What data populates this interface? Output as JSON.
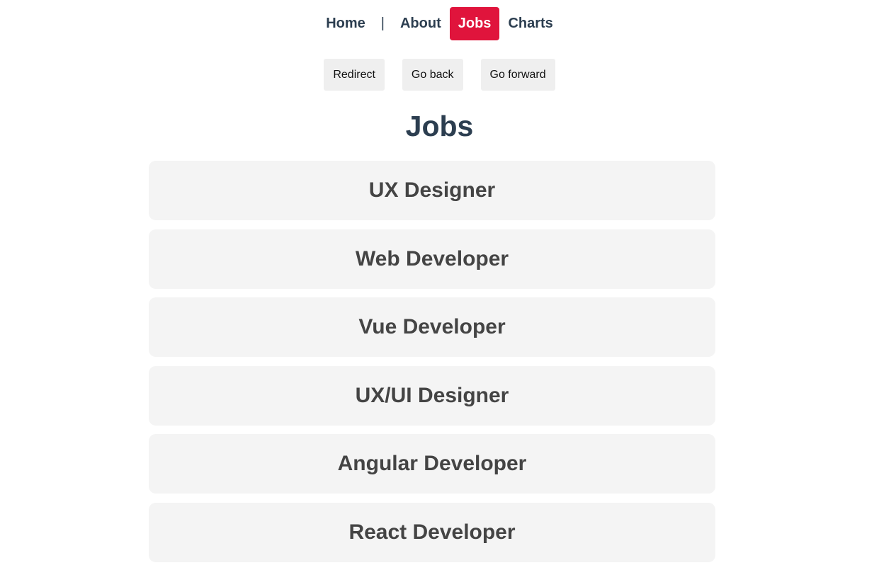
{
  "nav": {
    "items": [
      {
        "label": "Home",
        "active": false
      },
      {
        "label": "About",
        "active": false
      },
      {
        "label": "Jobs",
        "active": true
      },
      {
        "label": "Charts",
        "active": false
      }
    ],
    "separator": "|"
  },
  "actions": {
    "redirect_label": "Redirect",
    "back_label": "Go back",
    "forward_label": "Go forward"
  },
  "page": {
    "title": "Jobs"
  },
  "jobs": [
    {
      "title": "UX Designer"
    },
    {
      "title": "Web Developer"
    },
    {
      "title": "Vue Developer"
    },
    {
      "title": "UX/UI Designer"
    },
    {
      "title": "Angular Developer"
    },
    {
      "title": "React Developer"
    }
  ],
  "colors": {
    "accent": "#e0143c",
    "text": "#2c3e50",
    "card_bg": "#f4f4f4",
    "card_text": "#444444"
  }
}
